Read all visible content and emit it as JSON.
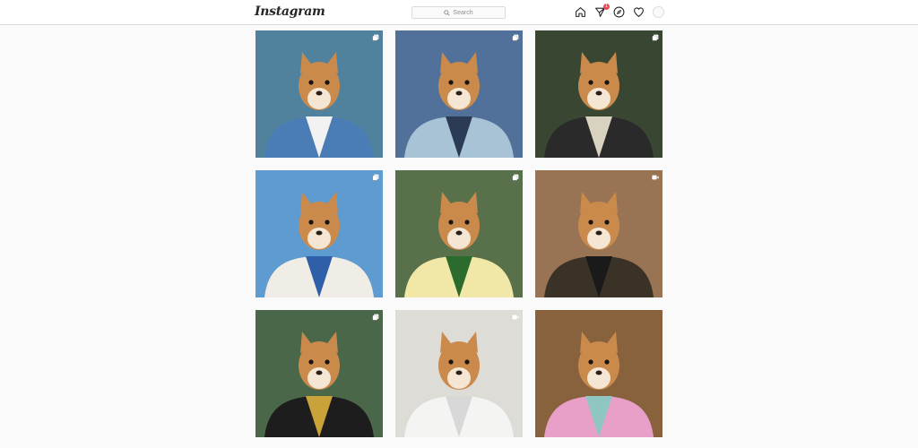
{
  "header": {
    "logo_text": "Instagram",
    "search_placeholder": "Search",
    "notifications_count": "1"
  },
  "colors": {
    "badge": "#ed4956",
    "border": "#dbdbdb",
    "background": "#fafafa"
  },
  "posts": [
    {
      "type": "carousel",
      "icon": "carousel-icon",
      "bg": "#5d8fc4",
      "jacket": "#4a7db5",
      "shirt": "#f2f2f2",
      "accent": "#2d5a2d"
    },
    {
      "type": "carousel",
      "icon": "carousel-icon",
      "bg": "#3c5f8f",
      "jacket": "#a9c3d6",
      "shirt": "#2b3b55",
      "accent": "#8fa7bd"
    },
    {
      "type": "carousel",
      "icon": "carousel-icon",
      "bg": "#2e3a2a",
      "jacket": "#2a2a2a",
      "shirt": "#d9d2c0",
      "accent": "#5c6b4a"
    },
    {
      "type": "carousel",
      "icon": "carousel-icon",
      "bg": "#4f8fc9",
      "jacket": "#f0ede6",
      "shirt": "#2e5fa8",
      "accent": "#8cc1e6"
    },
    {
      "type": "carousel",
      "icon": "carousel-icon",
      "bg": "#3f5a35",
      "jacket": "#f1e8a8",
      "shirt": "#2c6b2e",
      "accent": "#a8b88a"
    },
    {
      "type": "video",
      "icon": "video-icon",
      "bg": "#8a5e3c",
      "jacket": "#3a3226",
      "shirt": "#1a1a1a",
      "accent": "#c9b79a"
    },
    {
      "type": "carousel",
      "icon": "carousel-icon",
      "bg": "#3e5b3e",
      "jacket": "#1d1d1d",
      "shirt": "#c9a23a",
      "accent": "#6f8f6a"
    },
    {
      "type": "video",
      "icon": "video-icon",
      "bg": "#e6e4e0",
      "jacket": "#f4f4f2",
      "shirt": "#d8d8d8",
      "accent": "#c9c5bd"
    },
    {
      "type": "none",
      "icon": "",
      "bg": "#6b5a3e",
      "jacket": "#e8a0c8",
      "shirt": "#8fc6c2",
      "accent": "#e07a3a"
    }
  ]
}
